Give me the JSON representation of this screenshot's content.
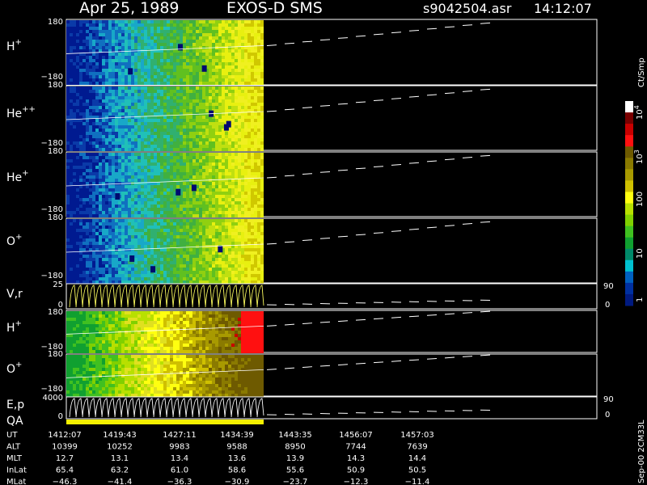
{
  "header": {
    "date": "Apr 25, 1989",
    "instrument": "EXOS-D SMS",
    "file": "s9042504.asr",
    "time": "14:12:07"
  },
  "panels": [
    {
      "label_base": "H",
      "label_sup": "+",
      "ymax": "180",
      "ymin": "−180"
    },
    {
      "label_base": "He",
      "label_sup": "++",
      "ymax": "180",
      "ymin": "−180"
    },
    {
      "label_base": "He",
      "label_sup": "+",
      "ymax": "180",
      "ymin": "−180"
    },
    {
      "label_base": "O",
      "label_sup": "+",
      "ymax": "180",
      "ymin": "−180"
    },
    {
      "label_base": "V,r",
      "label_sup": "",
      "ymax": "25",
      "ymin": "0",
      "right_top": "90",
      "right_bottom": "0"
    },
    {
      "label_base": "H",
      "label_sup": "+",
      "ymax": "180",
      "ymin": "−180"
    },
    {
      "label_base": "O",
      "label_sup": "+",
      "ymax": "180",
      "ymin": "−180"
    },
    {
      "label_base": "E,p",
      "label_sup": "",
      "ymax": "4000",
      "ymin": "0",
      "right_top": "90",
      "right_bottom": "0"
    }
  ],
  "qa_label": "QA",
  "colorbar": {
    "unit": "Ct/Smp",
    "ticks": [
      {
        "text": "10",
        "sup": "4"
      },
      {
        "text": "10",
        "sup": "3"
      },
      {
        "text": "100",
        "sup": ""
      },
      {
        "text": "10",
        "sup": ""
      },
      {
        "text": "1",
        "sup": ""
      }
    ],
    "colors": [
      "#ffffff",
      "#7a0000",
      "#c80000",
      "#ff1010",
      "#6e5a00",
      "#8a7a00",
      "#a89a00",
      "#cfc000",
      "#ffff10",
      "#b8e000",
      "#80d000",
      "#40c020",
      "#10a030",
      "#008a6a",
      "#00c0d0",
      "#0060c0",
      "#0030a0",
      "#001a80"
    ]
  },
  "side_note": "Sep-00 2CM33L",
  "footer": {
    "rows": [
      {
        "name": "UT",
        "values": [
          "1412:07",
          "1419:43",
          "1427:11",
          "1434:39",
          "1443:35",
          "1456:07",
          "1457:03"
        ]
      },
      {
        "name": "ALT",
        "values": [
          "10399",
          "10252",
          "9983",
          "9588",
          "8950",
          "7744",
          "7639"
        ]
      },
      {
        "name": "MLT",
        "values": [
          "12.7",
          "13.1",
          "13.4",
          "13.6",
          "13.9",
          "14.3",
          "14.4"
        ]
      },
      {
        "name": "InLat",
        "values": [
          "65.4",
          "63.2",
          "61.0",
          "58.6",
          "55.6",
          "50.9",
          "50.5"
        ]
      },
      {
        "name": "MLat",
        "values": [
          "−46.3",
          "−41.4",
          "−36.3",
          "−30.9",
          "−23.7",
          "−12.3",
          "−11.4"
        ]
      }
    ]
  },
  "chart_data": {
    "type": "heatmap",
    "title": "Apr 25, 1989 EXOS-D SMS",
    "x_tick_labels": [
      "1412:07",
      "1419:43",
      "1427:11",
      "1434:39",
      "1443:35",
      "1456:07",
      "1457:03"
    ],
    "panel_ylims": [
      [
        -180,
        180
      ],
      [
        -180,
        180
      ],
      [
        -180,
        180
      ],
      [
        -180,
        180
      ],
      [
        0,
        25
      ],
      [
        -180,
        180
      ],
      [
        -180,
        180
      ],
      [
        0,
        4000
      ]
    ],
    "colorbar_range": [
      1,
      10000
    ],
    "colorbar_scale": "log",
    "data_coverage_fraction": 0.42
  }
}
